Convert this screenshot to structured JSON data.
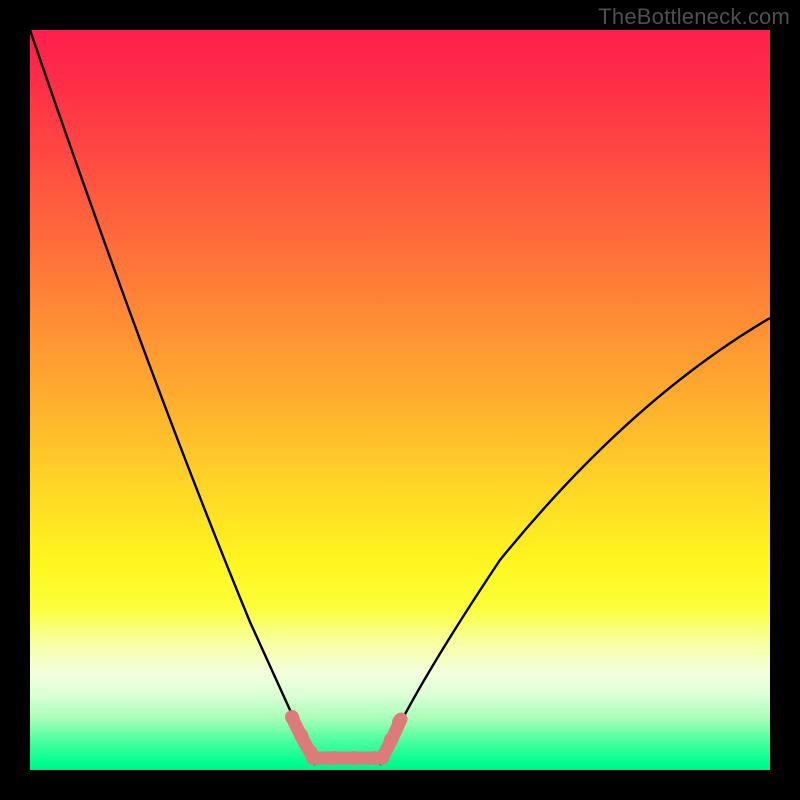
{
  "watermark": "TheBottleneck.com",
  "chart_data": {
    "type": "line",
    "title": "",
    "xlabel": "",
    "ylabel": "",
    "xlim": [
      0,
      100
    ],
    "ylim": [
      0,
      100
    ],
    "series": [
      {
        "name": "left-curve",
        "x": [
          0,
          5,
          10,
          15,
          20,
          25,
          30,
          35,
          37,
          39
        ],
        "values": [
          100,
          86,
          72,
          58,
          45,
          32,
          20,
          9,
          4,
          0
        ]
      },
      {
        "name": "right-curve",
        "x": [
          47,
          49,
          52,
          58,
          65,
          75,
          85,
          95,
          100
        ],
        "values": [
          0,
          4,
          9,
          18,
          28,
          39,
          49,
          57,
          61
        ]
      },
      {
        "name": "flat-bottom-marker",
        "x": [
          36.5,
          47.5
        ],
        "values": [
          1.8,
          1.8
        ]
      }
    ],
    "background_gradient": {
      "top_color": "#ff1f4b",
      "bottom_color": "#00ef87",
      "description": "vertical rainbow gradient red→orange→yellow→pale→green"
    },
    "curve_stroke_color": "#000000",
    "marker_stroke_color": "#e57373",
    "frame_color": "#000000"
  }
}
